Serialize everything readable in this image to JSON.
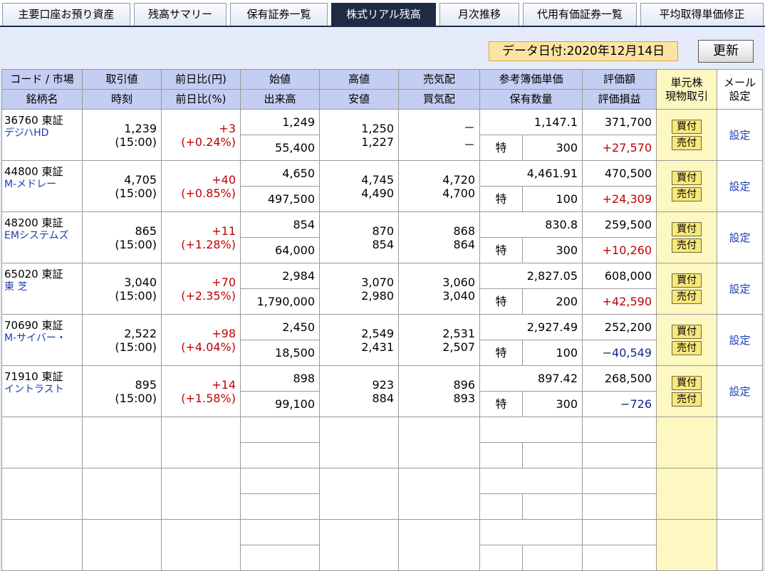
{
  "tabs": [
    {
      "label": "主要口座お預り資産",
      "active": false
    },
    {
      "label": "残高サマリー",
      "active": false
    },
    {
      "label": "保有証券一覧",
      "active": false
    },
    {
      "label": "株式リアル残高",
      "active": true
    },
    {
      "label": "月次推移",
      "active": false
    },
    {
      "label": "代用有価証券一覧",
      "active": false
    },
    {
      "label": "平均取得単価修正",
      "active": false
    }
  ],
  "date_label": "データ日付:2020年12月14日",
  "refresh_label": "更新",
  "headers": {
    "code_market": "コード / 市場",
    "name": "銘柄名",
    "price": "取引値",
    "time": "時刻",
    "change_yen": "前日比(円)",
    "change_pct": "前日比(%)",
    "open": "始値",
    "volume": "出来高",
    "high": "高値",
    "low": "安値",
    "ask": "売気配",
    "bid": "買気配",
    "book_price": "参考簿価単価",
    "holding_qty": "保有数量",
    "eval_amount": "評価額",
    "eval_pl": "評価損益",
    "unit_trade_1": "単元株",
    "unit_trade_2": "現物取引",
    "mail_1": "メール",
    "mail_2": "設定"
  },
  "buy_label": "買付",
  "sell_label": "売付",
  "setting_label": "設定",
  "rows": [
    {
      "code": "36760 東証",
      "name": "デジハHD",
      "price": "1,239",
      "time": "(15:00)",
      "chg": "+3",
      "chg_pct": "(+0.24%)",
      "open": "1,249",
      "volume": "55,400",
      "high": "1,250",
      "low": "1,227",
      "ask": "－",
      "bid": "－",
      "book": "1,147.1",
      "tok": "特",
      "qty": "300",
      "eval": "371,700",
      "pl": "+27,570",
      "pl_neg": false
    },
    {
      "code": "44800 東証",
      "name": "M-メドレー",
      "price": "4,705",
      "time": "(15:00)",
      "chg": "+40",
      "chg_pct": "(+0.85%)",
      "open": "4,650",
      "volume": "497,500",
      "high": "4,745",
      "low": "4,490",
      "ask": "4,720",
      "bid": "4,700",
      "book": "4,461.91",
      "tok": "特",
      "qty": "100",
      "eval": "470,500",
      "pl": "+24,309",
      "pl_neg": false
    },
    {
      "code": "48200 東証",
      "name": "EMシステムズ",
      "price": "865",
      "time": "(15:00)",
      "chg": "+11",
      "chg_pct": "(+1.28%)",
      "open": "854",
      "volume": "64,000",
      "high": "870",
      "low": "854",
      "ask": "868",
      "bid": "864",
      "book": "830.8",
      "tok": "特",
      "qty": "300",
      "eval": "259,500",
      "pl": "+10,260",
      "pl_neg": false
    },
    {
      "code": "65020 東証",
      "name": "東 芝",
      "price": "3,040",
      "time": "(15:00)",
      "chg": "+70",
      "chg_pct": "(+2.35%)",
      "open": "2,984",
      "volume": "1,790,000",
      "high": "3,070",
      "low": "2,980",
      "ask": "3,060",
      "bid": "3,040",
      "book": "2,827.05",
      "tok": "特",
      "qty": "200",
      "eval": "608,000",
      "pl": "+42,590",
      "pl_neg": false
    },
    {
      "code": "70690 東証",
      "name": "M-サイバー・",
      "price": "2,522",
      "time": "(15:00)",
      "chg": "+98",
      "chg_pct": "(+4.04%)",
      "open": "2,450",
      "volume": "18,500",
      "high": "2,549",
      "low": "2,431",
      "ask": "2,531",
      "bid": "2,507",
      "book": "2,927.49",
      "tok": "特",
      "qty": "100",
      "eval": "252,200",
      "pl": "−40,549",
      "pl_neg": true
    },
    {
      "code": "71910 東証",
      "name": "イントラスト",
      "price": "895",
      "time": "(15:00)",
      "chg": "+14",
      "chg_pct": "(+1.58%)",
      "open": "898",
      "volume": "99,100",
      "high": "923",
      "low": "884",
      "ask": "896",
      "bid": "893",
      "book": "897.42",
      "tok": "特",
      "qty": "300",
      "eval": "268,500",
      "pl": "−726",
      "pl_neg": true
    }
  ],
  "colors": {
    "header_bg": "#c4cdf2",
    "active_tab": "#1f2a45",
    "positive": "#c00000",
    "negative": "#14288c",
    "unit_col": "#fdf8c2"
  }
}
